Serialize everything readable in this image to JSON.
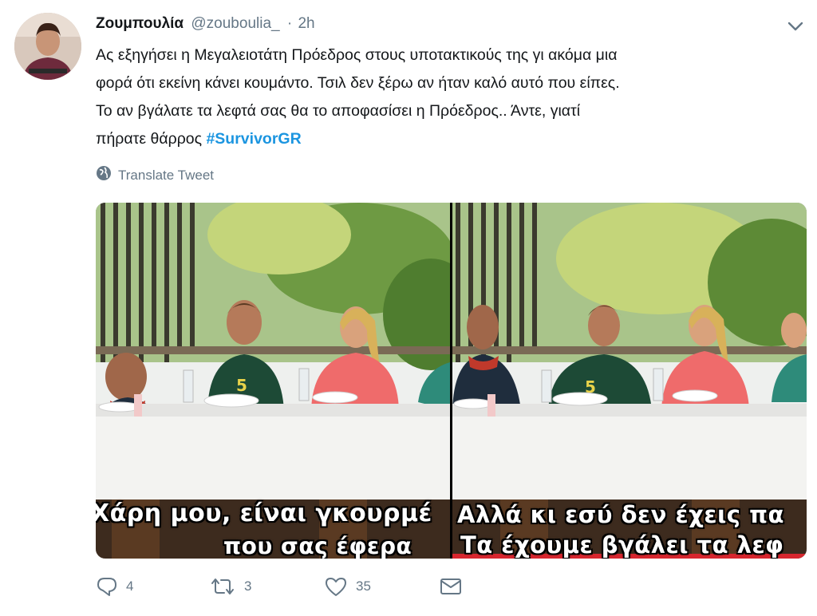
{
  "tweet": {
    "display_name": "Ζουμπουλία",
    "handle": "@zouboulia_",
    "separator": "·",
    "time": "2h",
    "text": "Ας εξηγήσει η Μεγαλειοτάτη Πρόεδρος στους υποτακτικούς της γι ακόμα μια\nφορά ότι εκείνη κάνει κουμάντο. Τσιλ δεν  ξέρω αν ήταν καλό αυτό που είπες.\nΤο αν βγάλατε τα λεφτά σας θα το αποφασίσει η Πρόεδρος.. Άντε,  γιατί\nπήρατε θάρρος ",
    "hashtag": "#SurvivorGR",
    "translate_label": "Translate Tweet"
  },
  "media": {
    "left_subtitle_line1": "Χάρη μου, είναι γκουρμέ",
    "left_subtitle_line2": "που σας έφερα",
    "right_subtitle_line1": "Αλλά κι εσύ δεν έχεις πα",
    "right_subtitle_line2": "Τα έχουμε βγάλει τα λεφ",
    "jersey_number": "5"
  },
  "actions": {
    "reply_count": "4",
    "retweet_count": "3",
    "like_count": "35"
  },
  "colors": {
    "link": "#1b95e0",
    "secondary_text": "#657786",
    "primary_text": "#14171a"
  },
  "icons": [
    "chevron-down-icon",
    "globe-icon",
    "reply-icon",
    "retweet-icon",
    "heart-icon",
    "message-icon"
  ]
}
